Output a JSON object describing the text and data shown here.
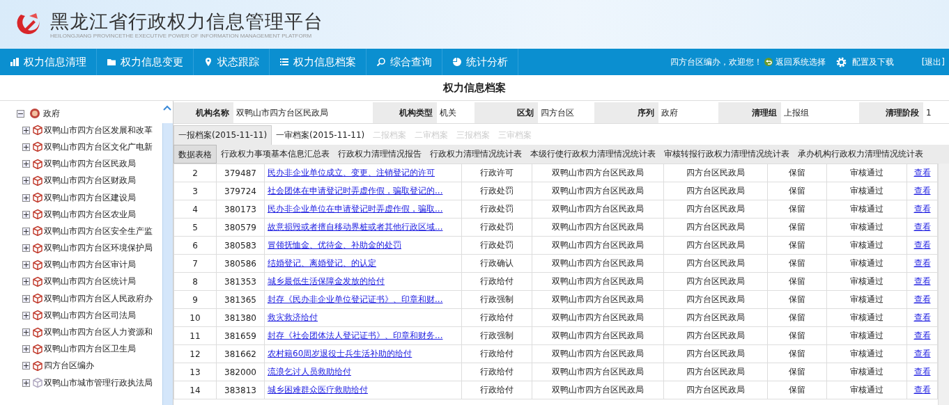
{
  "header": {
    "title": "黑龙江省行政权力信息管理平台",
    "subtitle": "HEILONGJIANG PROVINCETHE EXECUTIVE POWER OF INFORMATION MANAGEMENT PLATFORM"
  },
  "nav": {
    "items": [
      {
        "label": "权力信息清理"
      },
      {
        "label": "权力信息变更"
      },
      {
        "label": "状态跟踪"
      },
      {
        "label": "权力信息档案"
      },
      {
        "label": "综合查询"
      },
      {
        "label": "统计分析"
      }
    ],
    "welcome": "四方台区编办，欢迎您！",
    "return": "返回系统选择",
    "config": "配置及下载",
    "logout": "[退出]"
  },
  "page_title": "权力信息档案",
  "tree": {
    "root": {
      "label": "政府",
      "expanded": true,
      "children": [
        {
          "label": "双鸭山市四方台区发展和改革",
          "disabled": false
        },
        {
          "label": "双鸭山市四方台区文化广电新",
          "disabled": false
        },
        {
          "label": "双鸭山市四方台区民政局",
          "disabled": false
        },
        {
          "label": "双鸭山市四方台区财政局",
          "disabled": false
        },
        {
          "label": "双鸭山市四方台区建设局",
          "disabled": false
        },
        {
          "label": "双鸭山市四方台区农业局",
          "disabled": false
        },
        {
          "label": "双鸭山市四方台区安全生产监",
          "disabled": false
        },
        {
          "label": "双鸭山市四方台区环境保护局",
          "disabled": false
        },
        {
          "label": "双鸭山市四方台区审计局",
          "disabled": false
        },
        {
          "label": "双鸭山市四方台区统计局",
          "disabled": false
        },
        {
          "label": "双鸭山市四方台区人民政府办",
          "disabled": false
        },
        {
          "label": "双鸭山市四方台区司法局",
          "disabled": false
        },
        {
          "label": "双鸭山市四方台区人力资源和",
          "disabled": false
        },
        {
          "label": "双鸭山市四方台区卫生局",
          "disabled": false
        },
        {
          "label": "四方台区编办",
          "disabled": false
        },
        {
          "label": "双鸭山市城市管理行政执法局",
          "disabled": true
        }
      ]
    }
  },
  "info": [
    {
      "label": "机构名称",
      "value": "双鸭山市四方台区民政局"
    },
    {
      "label": "机构类型",
      "value": "机关"
    },
    {
      "label": "区划",
      "value": "四方台区"
    },
    {
      "label": "序列",
      "value": "政府"
    },
    {
      "label": "清理组",
      "value": "上报组"
    },
    {
      "label": "清理阶段",
      "value": "1"
    }
  ],
  "archive_tabs": [
    {
      "label": "一报档案(2015-11-11)",
      "selected": true,
      "disabled": false
    },
    {
      "label": "一审档案(2015-11-11)",
      "selected": false,
      "disabled": false
    },
    {
      "label": "二报档案",
      "selected": false,
      "disabled": true
    },
    {
      "label": "二审档案",
      "selected": false,
      "disabled": true
    },
    {
      "label": "三报档案",
      "selected": false,
      "disabled": true
    },
    {
      "label": "三审档案",
      "selected": false,
      "disabled": true
    }
  ],
  "sub_tabs": [
    {
      "label": "数据表格",
      "selected": true
    },
    {
      "label": "行政权力事项基本信息汇总表",
      "selected": false
    },
    {
      "label": "行政权力清理情况报告",
      "selected": false
    },
    {
      "label": "行政权力清理情况统计表",
      "selected": false
    },
    {
      "label": "本级行使行政权力清理情况统计表",
      "selected": false
    },
    {
      "label": "审核转报行政权力清理情况统计表",
      "selected": false
    },
    {
      "label": "承办机构行政权力清理情况统计表",
      "selected": false
    }
  ],
  "table": {
    "rows": [
      [
        "2",
        "379487",
        "民办非企业单位成立、变更、注销登记的许可",
        "行政许可",
        "双鸭山市四方台区民政局",
        "四方台区民政局",
        "保留",
        "审核通过",
        "查看"
      ],
      [
        "3",
        "379724",
        "社会团体在申请登记时弄虚作假，骗取登记的...",
        "行政处罚",
        "双鸭山市四方台区民政局",
        "四方台区民政局",
        "保留",
        "审核通过",
        "查看"
      ],
      [
        "4",
        "380173",
        "民办非企业单位在申请登记时弄虚作假，骗取...",
        "行政处罚",
        "双鸭山市四方台区民政局",
        "四方台区民政局",
        "保留",
        "审核通过",
        "查看"
      ],
      [
        "5",
        "380579",
        "故意损毁或者擅自移动界桩或者其他行政区域...",
        "行政处罚",
        "双鸭山市四方台区民政局",
        "四方台区民政局",
        "保留",
        "审核通过",
        "查看"
      ],
      [
        "6",
        "380583",
        "冒领抚恤金、优待金、补助金的处罚",
        "行政处罚",
        "双鸭山市四方台区民政局",
        "四方台区民政局",
        "保留",
        "审核通过",
        "查看"
      ],
      [
        "7",
        "380586",
        "结婚登记、离婚登记、的认定",
        "行政确认",
        "双鸭山市四方台区民政局",
        "四方台区民政局",
        "保留",
        "审核通过",
        "查看"
      ],
      [
        "8",
        "381353",
        "城乡最低生活保障金发放的给付",
        "行政给付",
        "双鸭山市四方台区民政局",
        "四方台区民政局",
        "保留",
        "审核通过",
        "查看"
      ],
      [
        "9",
        "381365",
        "封存《民办非企业单位登记证书》、印章和财...",
        "行政强制",
        "双鸭山市四方台区民政局",
        "四方台区民政局",
        "保留",
        "审核通过",
        "查看"
      ],
      [
        "10",
        "381380",
        "救灾救济给付",
        "行政给付",
        "双鸭山市四方台区民政局",
        "四方台区民政局",
        "保留",
        "审核通过",
        "查看"
      ],
      [
        "11",
        "381659",
        "封存《社会团体法人登记证书》、印章和财务...",
        "行政强制",
        "双鸭山市四方台区民政局",
        "四方台区民政局",
        "保留",
        "审核通过",
        "查看"
      ],
      [
        "12",
        "381662",
        "农村籍60周岁退役士兵生活补助的给付",
        "行政给付",
        "双鸭山市四方台区民政局",
        "四方台区民政局",
        "保留",
        "审核通过",
        "查看"
      ],
      [
        "13",
        "382000",
        "流浪乞讨人员救助给付",
        "行政给付",
        "双鸭山市四方台区民政局",
        "四方台区民政局",
        "保留",
        "审核通过",
        "查看"
      ],
      [
        "14",
        "383813",
        "城乡困难群众医疗救助给付",
        "行政给付",
        "双鸭山市四方台区民政局",
        "四方台区民政局",
        "保留",
        "审核通过",
        "查看"
      ]
    ]
  }
}
